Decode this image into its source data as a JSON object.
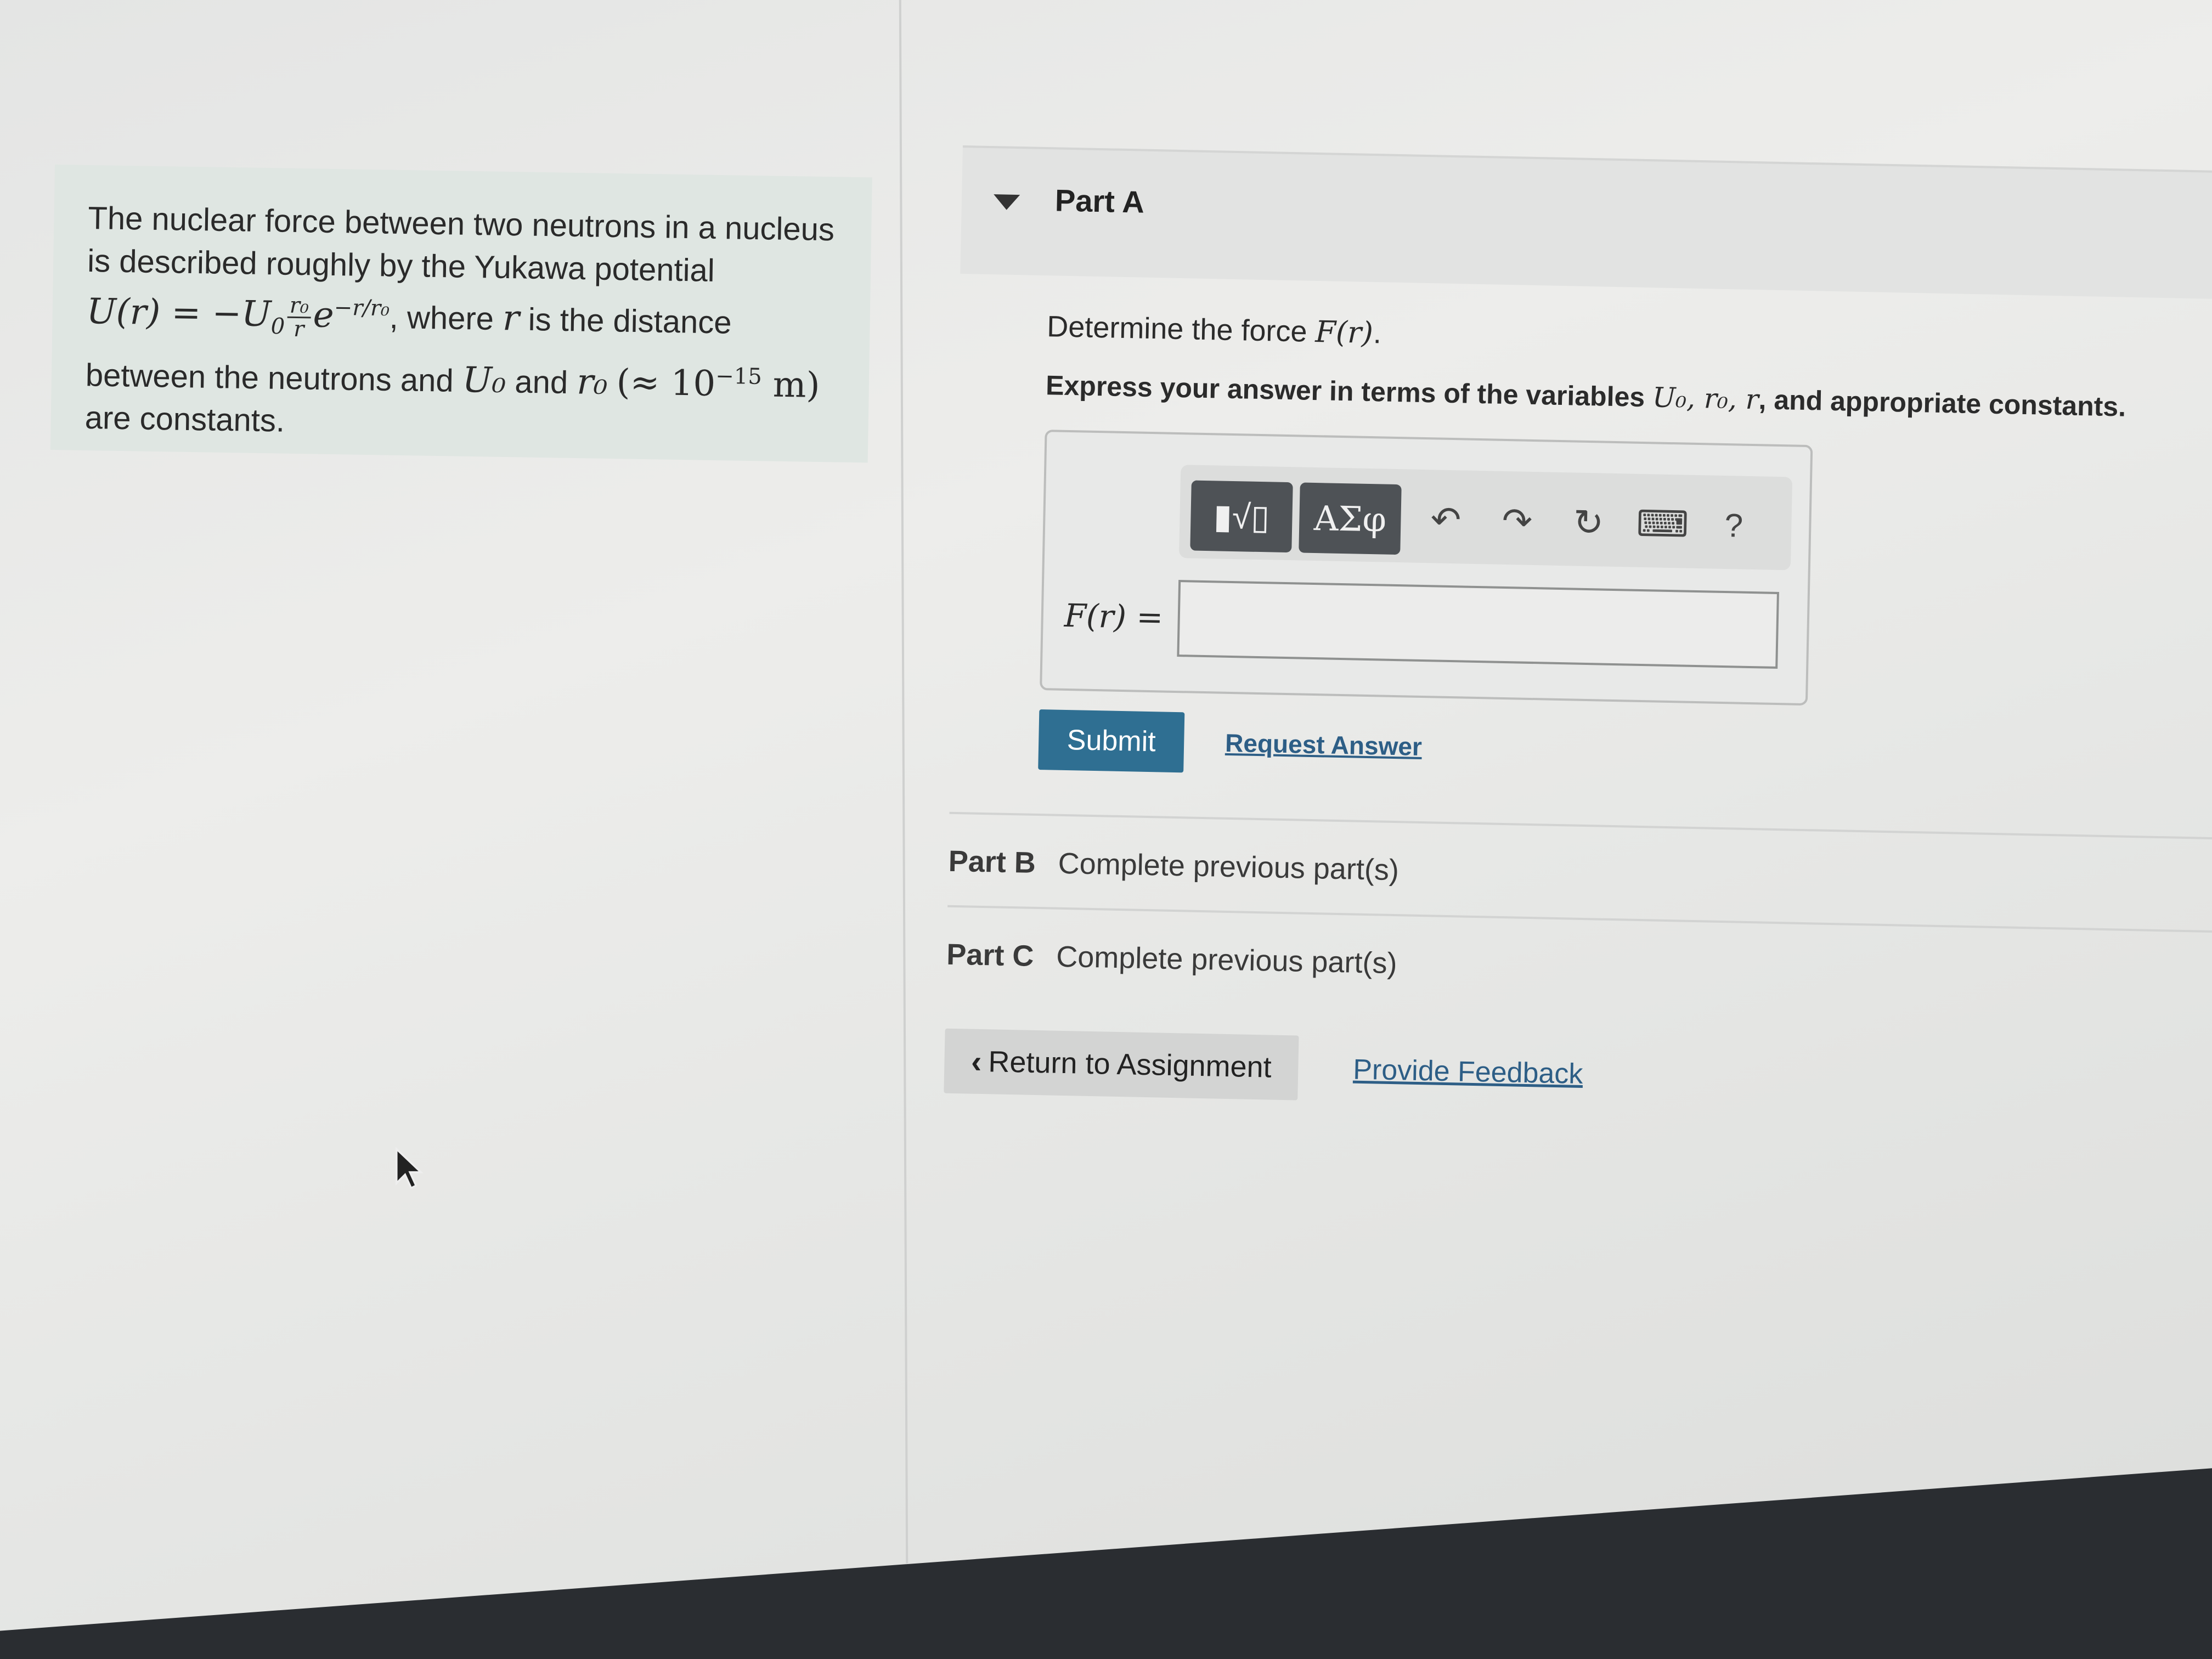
{
  "problem": {
    "line1": "The nuclear force between two neutrons in a nucleus",
    "line2": "is described roughly by the Yukawa potential",
    "potential_lhs": "U(r) = −U",
    "potential_sub": "0",
    "frac_num": "r₀",
    "frac_den": "r",
    "exp_base": "e",
    "exp_power": "−r/r₀",
    "where_text": ", where",
    "r_var": "r",
    "is_distance": "is the distance",
    "line4_a": "between the neutrons and",
    "U0": "U₀",
    "and_text": "and",
    "r0": "r₀",
    "approx": "(≈ 10",
    "approx_exp": "−15",
    "approx_unit": " m)",
    "line5": "are constants."
  },
  "part_a": {
    "title": "Part A",
    "question_prefix": "Determine the force",
    "question_math": "F(r)",
    "question_suffix": ".",
    "instruction_prefix": "Express your answer in terms of the variables",
    "instruction_vars": "U₀, r₀, r",
    "instruction_suffix": ", and appropriate constants.",
    "toolbar": {
      "templates_icon": "▮√▯",
      "symbols_label": "ΑΣφ",
      "undo_icon": "↶",
      "redo_icon": "↷",
      "reset_icon": "↻",
      "keyboard_icon": "⌨",
      "help_icon": "?"
    },
    "answer_label": "F(r) =",
    "answer_value": "",
    "submit_label": "Submit",
    "request_answer_label": "Request Answer"
  },
  "other_parts": [
    {
      "name": "Part B",
      "status": "Complete previous part(s)"
    },
    {
      "name": "Part C",
      "status": "Complete previous part(s)"
    }
  ],
  "footer": {
    "return_label": "Return to Assignment",
    "feedback_label": "Provide Feedback"
  },
  "colors": {
    "submit_bg": "#2f6f92",
    "link": "#2d5e86",
    "problem_bg": "#dfe6e2"
  }
}
